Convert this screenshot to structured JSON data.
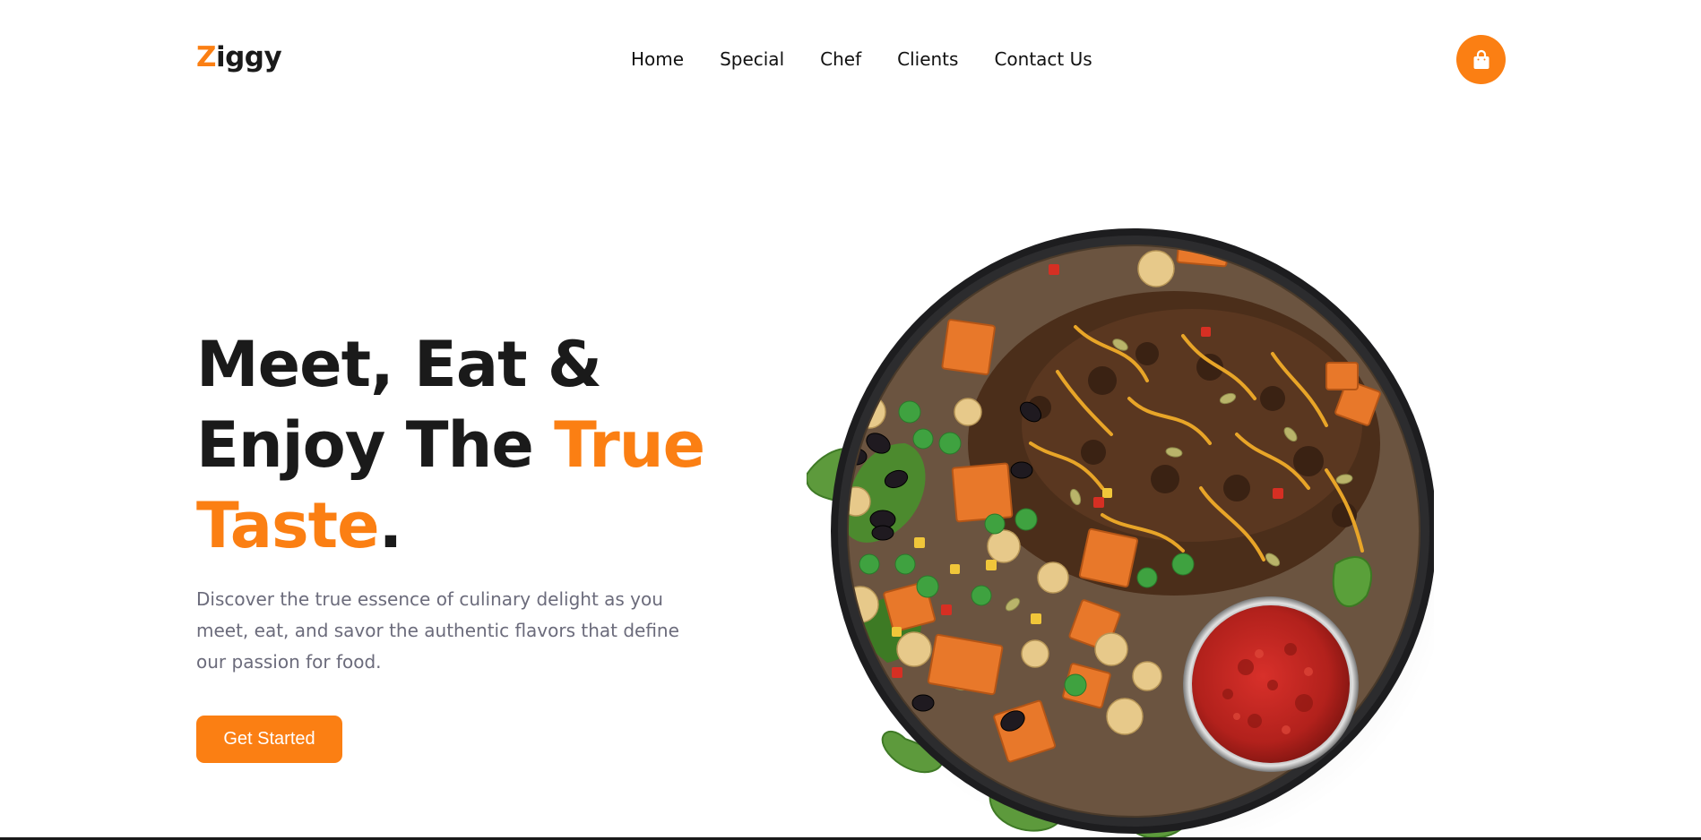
{
  "header": {
    "logo": {
      "first": "Z",
      "rest": "iggy"
    },
    "nav": [
      "Home",
      "Special",
      "Chef",
      "Clients",
      "Contact Us"
    ],
    "cart_icon": "shopping-bag-icon"
  },
  "hero": {
    "title_line1": "Meet, Eat &",
    "title_line2_plain": "Enjoy The ",
    "title_line2_accent": "True",
    "title_line3_accent": "Taste",
    "title_line3_end": ".",
    "description": "Discover the true essence of culinary delight as you meet, eat, and savor the authentic flavors that define our passion for food.",
    "cta_label": "Get Started"
  },
  "colors": {
    "accent": "#fb7f13",
    "text": "#1a1a1a",
    "muted": "#6b6b7b"
  }
}
